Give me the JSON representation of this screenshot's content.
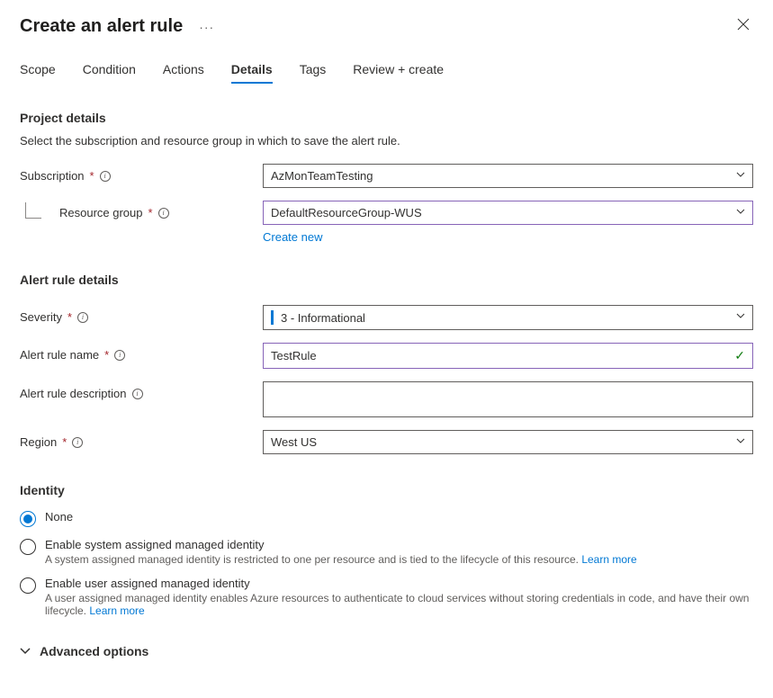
{
  "header": {
    "title": "Create an alert rule"
  },
  "tabs": [
    "Scope",
    "Condition",
    "Actions",
    "Details",
    "Tags",
    "Review + create"
  ],
  "activeTabIndex": 3,
  "sections": {
    "projectDetails": {
      "title": "Project details",
      "desc": "Select the subscription and resource group in which to save the alert rule.",
      "subscriptionLabel": "Subscription",
      "subscriptionValue": "AzMonTeamTesting",
      "resourceGroupLabel": "Resource group",
      "resourceGroupValue": "DefaultResourceGroup-WUS",
      "createNewLabel": "Create new"
    },
    "ruleDetails": {
      "title": "Alert rule details",
      "severityLabel": "Severity",
      "severityValue": "3 - Informational",
      "nameLabel": "Alert rule name",
      "nameValue": "TestRule",
      "descLabel": "Alert rule description",
      "descValue": "",
      "regionLabel": "Region",
      "regionValue": "West US"
    },
    "identity": {
      "title": "Identity",
      "options": [
        {
          "label": "None",
          "desc": "",
          "selected": true
        },
        {
          "label": "Enable system assigned managed identity",
          "desc": "A system assigned managed identity is restricted to one per resource and is tied to the lifecycle of this resource.",
          "learnMore": "Learn more",
          "selected": false
        },
        {
          "label": "Enable user assigned managed identity",
          "desc": "A user assigned managed identity enables Azure resources to authenticate to cloud services without storing credentials in code, and have their own lifecycle.",
          "learnMore": "Learn more",
          "selected": false
        }
      ]
    },
    "advanced": {
      "label": "Advanced options"
    }
  }
}
